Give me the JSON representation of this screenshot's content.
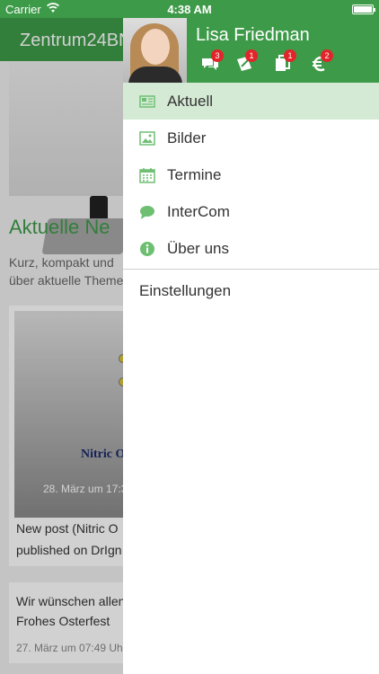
{
  "status_bar": {
    "carrier": "Carrier",
    "time": "4:38 AM"
  },
  "background": {
    "app_title": "Zentrum24BN",
    "heading": "Aktuelle Ne",
    "intro": "Kurz, kompakt und über aktuelle Theme",
    "post1": {
      "image_text": "Nitric O",
      "date": "28. März um 17:3",
      "text": "New post (Nitric O published on DrIgn"
    },
    "post2": {
      "text": "Wir wünschen allen Frohes Osterfest",
      "date": "27. März um 07:49 Uh"
    }
  },
  "drawer": {
    "user_name": "Lisa Friedman",
    "header_icons": [
      {
        "icon": "chat-bubbles-icon",
        "badge": "3"
      },
      {
        "icon": "edit-sticker-icon",
        "badge": "1"
      },
      {
        "icon": "documents-icon",
        "badge": "1"
      },
      {
        "icon": "euro-icon",
        "badge": "2"
      }
    ],
    "menu": [
      {
        "label": "Aktuell",
        "icon": "newspaper-icon",
        "active": true
      },
      {
        "label": "Bilder",
        "icon": "image-icon",
        "active": false
      },
      {
        "label": "Termine",
        "icon": "calendar-icon",
        "active": false
      },
      {
        "label": "InterCom",
        "icon": "speech-bubble-icon",
        "active": false
      },
      {
        "label": "Über uns",
        "icon": "info-icon",
        "active": false
      }
    ],
    "settings_label": "Einstellungen"
  },
  "colors": {
    "brand_green": "#3d9a48",
    "active_row": "#d5ead5",
    "badge_red": "#e2252b"
  }
}
